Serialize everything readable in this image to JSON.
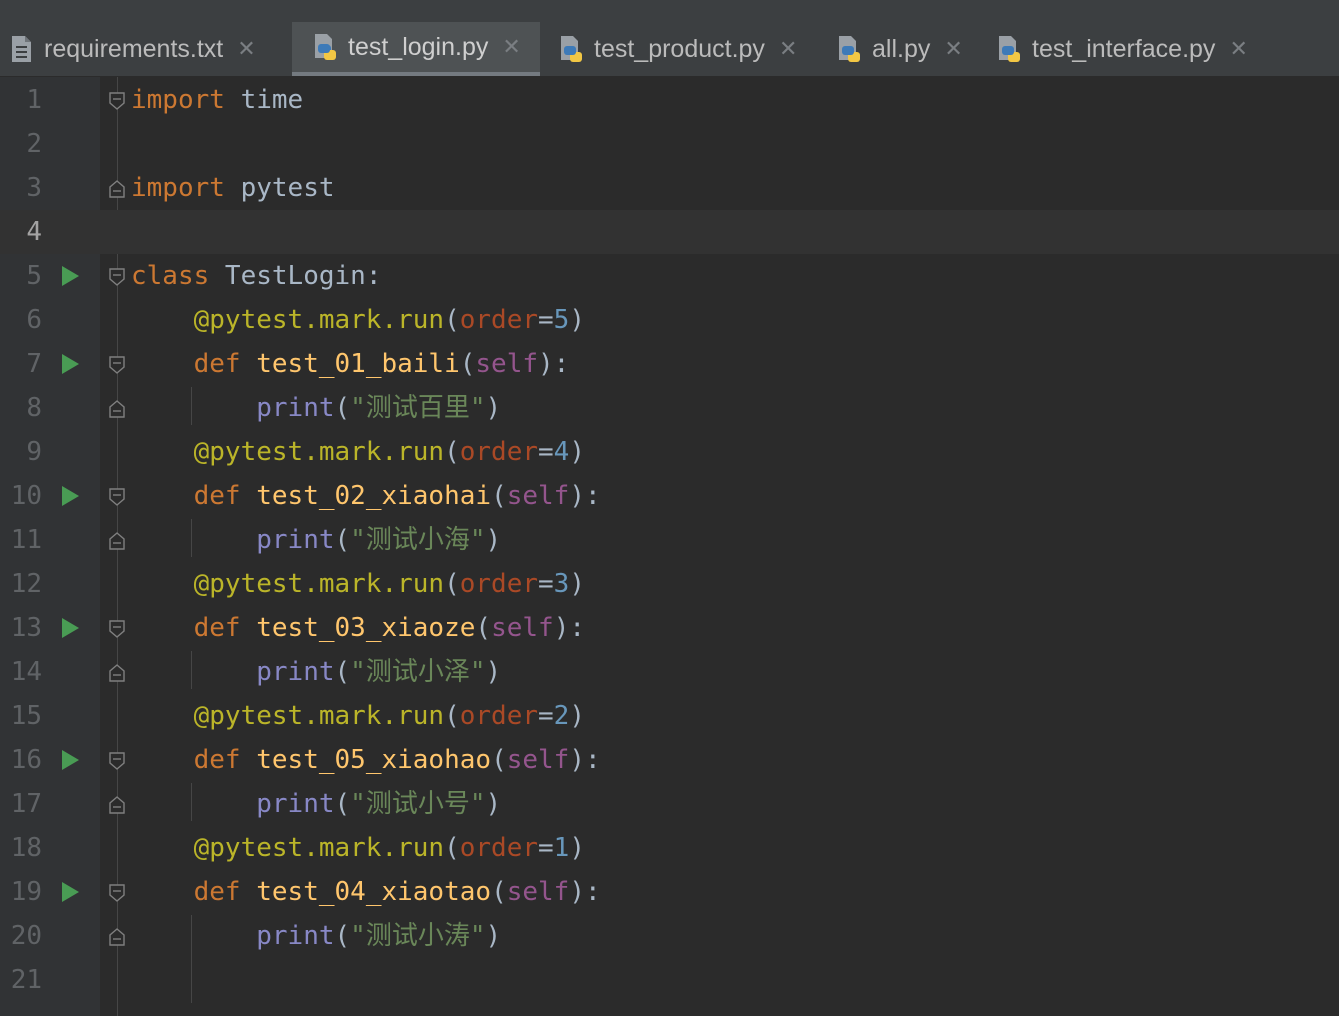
{
  "tabs": [
    {
      "label": "requirements.txt",
      "icon": "text-file-icon",
      "active": false
    },
    {
      "label": "test_login.py",
      "icon": "python-file-icon",
      "active": true
    },
    {
      "label": "test_product.py",
      "icon": "python-file-icon",
      "active": false
    },
    {
      "label": "all.py",
      "icon": "python-file-icon",
      "active": false
    },
    {
      "label": "test_interface.py",
      "icon": "python-file-icon",
      "active": false
    }
  ],
  "editor": {
    "current_line": 4,
    "lines": [
      {
        "n": "1",
        "run": false,
        "fold": "start",
        "tokens": [
          [
            "kw",
            "import"
          ],
          [
            "plain",
            " time"
          ]
        ]
      },
      {
        "n": "2",
        "run": false,
        "fold": "",
        "tokens": []
      },
      {
        "n": "3",
        "run": false,
        "fold": "end",
        "tokens": [
          [
            "kw",
            "import"
          ],
          [
            "plain",
            " pytest"
          ]
        ]
      },
      {
        "n": "4",
        "run": false,
        "fold": "",
        "tokens": []
      },
      {
        "n": "5",
        "run": true,
        "fold": "start",
        "tokens": [
          [
            "kw",
            "class"
          ],
          [
            "plain",
            " TestLogin:"
          ]
        ]
      },
      {
        "n": "6",
        "run": false,
        "fold": "",
        "tokens": [
          [
            "plain",
            "    "
          ],
          [
            "dec",
            "@pytest.mark.run"
          ],
          [
            "plain",
            "("
          ],
          [
            "param",
            "order"
          ],
          [
            "plain",
            "="
          ],
          [
            "num",
            "5"
          ],
          [
            "plain",
            ")"
          ]
        ]
      },
      {
        "n": "7",
        "run": true,
        "fold": "start",
        "tokens": [
          [
            "plain",
            "    "
          ],
          [
            "kw",
            "def"
          ],
          [
            "plain",
            " "
          ],
          [
            "fn",
            "test_01_baili"
          ],
          [
            "plain",
            "("
          ],
          [
            "self",
            "self"
          ],
          [
            "plain",
            "):"
          ]
        ]
      },
      {
        "n": "8",
        "run": false,
        "fold": "end",
        "tokens": [
          [
            "plain",
            "        "
          ],
          [
            "builtin",
            "print"
          ],
          [
            "plain",
            "("
          ],
          [
            "str",
            "\"测试百里\""
          ],
          [
            "plain",
            ")"
          ]
        ]
      },
      {
        "n": "9",
        "run": false,
        "fold": "",
        "tokens": [
          [
            "plain",
            "    "
          ],
          [
            "dec",
            "@pytest.mark.run"
          ],
          [
            "plain",
            "("
          ],
          [
            "param",
            "order"
          ],
          [
            "plain",
            "="
          ],
          [
            "num",
            "4"
          ],
          [
            "plain",
            ")"
          ]
        ]
      },
      {
        "n": "10",
        "run": true,
        "fold": "start",
        "tokens": [
          [
            "plain",
            "    "
          ],
          [
            "kw",
            "def"
          ],
          [
            "plain",
            " "
          ],
          [
            "fn",
            "test_02_xiaohai"
          ],
          [
            "plain",
            "("
          ],
          [
            "self",
            "self"
          ],
          [
            "plain",
            "):"
          ]
        ]
      },
      {
        "n": "11",
        "run": false,
        "fold": "end",
        "tokens": [
          [
            "plain",
            "        "
          ],
          [
            "builtin",
            "print"
          ],
          [
            "plain",
            "("
          ],
          [
            "str",
            "\"测试小海\""
          ],
          [
            "plain",
            ")"
          ]
        ]
      },
      {
        "n": "12",
        "run": false,
        "fold": "",
        "tokens": [
          [
            "plain",
            "    "
          ],
          [
            "dec",
            "@pytest.mark.run"
          ],
          [
            "plain",
            "("
          ],
          [
            "param",
            "order"
          ],
          [
            "plain",
            "="
          ],
          [
            "num",
            "3"
          ],
          [
            "plain",
            ")"
          ]
        ]
      },
      {
        "n": "13",
        "run": true,
        "fold": "start",
        "tokens": [
          [
            "plain",
            "    "
          ],
          [
            "kw",
            "def"
          ],
          [
            "plain",
            " "
          ],
          [
            "fn",
            "test_03_xiaoze"
          ],
          [
            "plain",
            "("
          ],
          [
            "self",
            "self"
          ],
          [
            "plain",
            "):"
          ]
        ]
      },
      {
        "n": "14",
        "run": false,
        "fold": "end",
        "tokens": [
          [
            "plain",
            "        "
          ],
          [
            "builtin",
            "print"
          ],
          [
            "plain",
            "("
          ],
          [
            "str",
            "\"测试小泽\""
          ],
          [
            "plain",
            ")"
          ]
        ]
      },
      {
        "n": "15",
        "run": false,
        "fold": "",
        "tokens": [
          [
            "plain",
            "    "
          ],
          [
            "dec",
            "@pytest.mark.run"
          ],
          [
            "plain",
            "("
          ],
          [
            "param",
            "order"
          ],
          [
            "plain",
            "="
          ],
          [
            "num",
            "2"
          ],
          [
            "plain",
            ")"
          ]
        ]
      },
      {
        "n": "16",
        "run": true,
        "fold": "start",
        "tokens": [
          [
            "plain",
            "    "
          ],
          [
            "kw",
            "def"
          ],
          [
            "plain",
            " "
          ],
          [
            "fn",
            "test_05_xiaohao"
          ],
          [
            "plain",
            "("
          ],
          [
            "self",
            "self"
          ],
          [
            "plain",
            "):"
          ]
        ]
      },
      {
        "n": "17",
        "run": false,
        "fold": "end",
        "tokens": [
          [
            "plain",
            "        "
          ],
          [
            "builtin",
            "print"
          ],
          [
            "plain",
            "("
          ],
          [
            "str",
            "\"测试小号\""
          ],
          [
            "plain",
            ")"
          ]
        ]
      },
      {
        "n": "18",
        "run": false,
        "fold": "",
        "tokens": [
          [
            "plain",
            "    "
          ],
          [
            "dec",
            "@pytest.mark.run"
          ],
          [
            "plain",
            "("
          ],
          [
            "param",
            "order"
          ],
          [
            "plain",
            "="
          ],
          [
            "num",
            "1"
          ],
          [
            "plain",
            ")"
          ]
        ]
      },
      {
        "n": "19",
        "run": true,
        "fold": "start",
        "tokens": [
          [
            "plain",
            "    "
          ],
          [
            "kw",
            "def"
          ],
          [
            "plain",
            " "
          ],
          [
            "fn",
            "test_04_xiaotao"
          ],
          [
            "plain",
            "("
          ],
          [
            "self",
            "self"
          ],
          [
            "plain",
            "):"
          ]
        ]
      },
      {
        "n": "20",
        "run": false,
        "fold": "end",
        "tokens": [
          [
            "plain",
            "        "
          ],
          [
            "builtin",
            "print"
          ],
          [
            "plain",
            "("
          ],
          [
            "str",
            "\"测试小涛\""
          ],
          [
            "plain",
            ")"
          ]
        ]
      },
      {
        "n": "21",
        "run": false,
        "fold": "",
        "tokens": []
      }
    ]
  }
}
